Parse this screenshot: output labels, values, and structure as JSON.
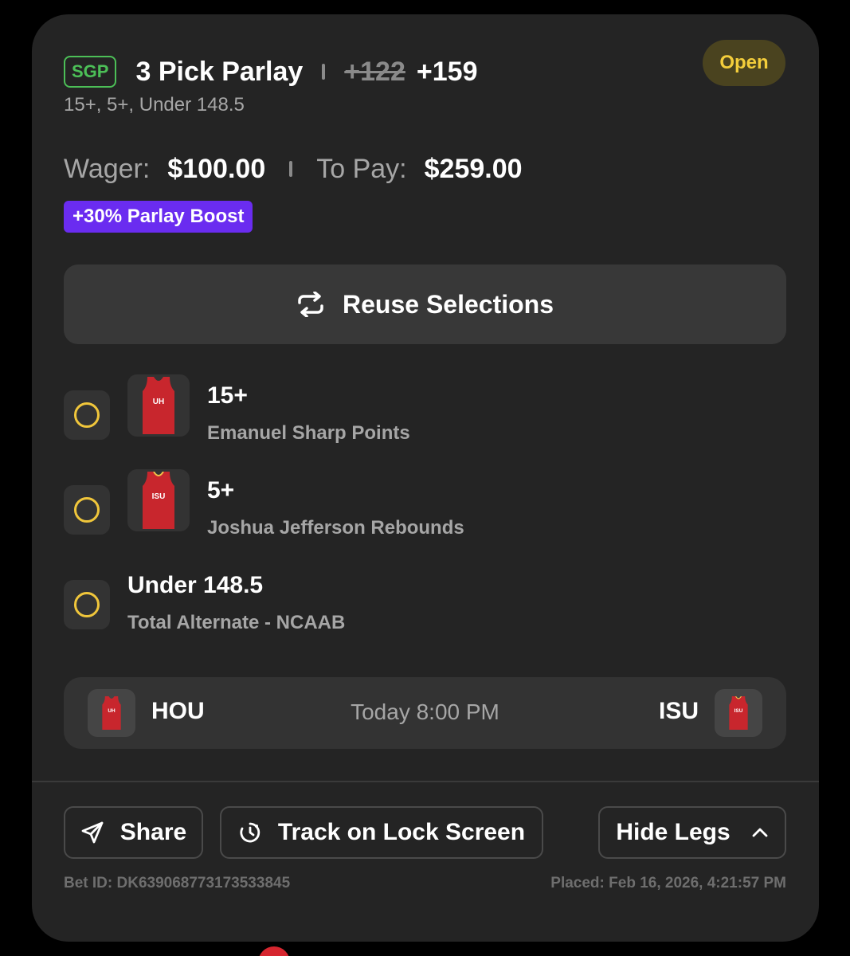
{
  "bet": {
    "badge": "SGP",
    "title": "3 Pick Parlay",
    "old_odds": "+122",
    "new_odds": "+159",
    "legs_summary": "15+, 5+, Under 148.5",
    "status": "Open"
  },
  "wager": {
    "wager_label": "Wager:",
    "wager_value": "$100.00",
    "topay_label": "To Pay:",
    "topay_value": "$259.00"
  },
  "boost": "+30% Parlay Boost",
  "reuse_label": "Reuse Selections",
  "legs": [
    {
      "title": "15+",
      "subtitle": "Emanuel Sharp Points",
      "jersey_text": "UH"
    },
    {
      "title": "5+",
      "subtitle": "Joshua Jefferson Rebounds",
      "jersey_text": "ISU"
    },
    {
      "title": "Under 148.5",
      "subtitle": "Total Alternate - NCAAB"
    }
  ],
  "game": {
    "home": "HOU",
    "time": "Today 8:00 PM",
    "away": "ISU",
    "home_jersey": "UH",
    "away_jersey": "ISU"
  },
  "actions": {
    "share": "Share",
    "track": "Track on Lock Screen",
    "hide_legs": "Hide Legs"
  },
  "footer": {
    "bet_id": "Bet ID: DK639068773173533845",
    "placed": "Placed: Feb 16, 2026, 4:21:57 PM"
  },
  "colors": {
    "card_bg": "#242424",
    "sgp_green": "#4cbf57",
    "open_yellow": "#f3cd3b",
    "boost_purple": "#6a2cf0",
    "leg_circle": "#f0c63b",
    "jersey_red": "#c8262d"
  },
  "icons": {
    "reuse": "repeat-icon",
    "share": "send-icon",
    "track": "timer-icon",
    "hide": "chevron-up-icon"
  }
}
